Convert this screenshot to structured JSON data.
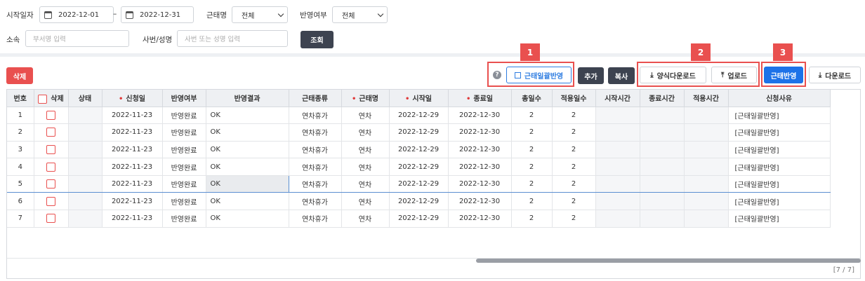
{
  "filters": {
    "start_date_label": "시작일자",
    "start_from": "2022-12-01",
    "date_sep": "–",
    "start_to": "2022-12-31",
    "type_label": "근태명",
    "type_value": "전체",
    "reflect_label": "반영여부",
    "reflect_value": "전체",
    "dept_label": "소속",
    "dept_placeholder": "부서명 입력",
    "emp_label": "사번/성명",
    "emp_placeholder": "사번 또는 성명 입력",
    "search_button": "조회"
  },
  "toolbar": {
    "delete_button": "삭제",
    "help_icon": "?",
    "bulk_reflect_button": "근태일괄반영",
    "add_button": "추가",
    "copy_button": "복사",
    "template_download_button": "양식다운로드",
    "upload_button": "업로드",
    "reflect_button": "근태반영",
    "download_button": "다운로드"
  },
  "annotations": [
    "1",
    "2",
    "3"
  ],
  "table": {
    "headers": {
      "no": "번호",
      "delete": "삭제",
      "status": "상태",
      "apply_date": "신청일",
      "reflected": "반영여부",
      "result": "반영결과",
      "category": "근태종류",
      "type": "근태명",
      "start": "시작일",
      "end": "종료일",
      "total_days": "총일수",
      "applied_days": "적용일수",
      "start_time": "시작시간",
      "end_time": "종료시간",
      "applied_time": "적용시간",
      "reason": "신청사유"
    },
    "rows": [
      {
        "no": "1",
        "apply_date": "2022-11-23",
        "reflected": "반영완료",
        "result": "OK",
        "category": "연차휴가",
        "type": "연차",
        "start": "2022-12-29",
        "end": "2022-12-30",
        "total_days": "2",
        "applied_days": "2",
        "reason": "[근태일괄반영]"
      },
      {
        "no": "2",
        "apply_date": "2022-11-23",
        "reflected": "반영완료",
        "result": "OK",
        "category": "연차휴가",
        "type": "연차",
        "start": "2022-12-29",
        "end": "2022-12-30",
        "total_days": "2",
        "applied_days": "2",
        "reason": "[근태일괄반영]"
      },
      {
        "no": "3",
        "apply_date": "2022-11-23",
        "reflected": "반영완료",
        "result": "OK",
        "category": "연차휴가",
        "type": "연차",
        "start": "2022-12-29",
        "end": "2022-12-30",
        "total_days": "2",
        "applied_days": "2",
        "reason": "[근태일괄반영]"
      },
      {
        "no": "4",
        "apply_date": "2022-11-23",
        "reflected": "반영완료",
        "result": "OK",
        "category": "연차휴가",
        "type": "연차",
        "start": "2022-12-29",
        "end": "2022-12-30",
        "total_days": "2",
        "applied_days": "2",
        "reason": "[근태일괄반영]"
      },
      {
        "no": "5",
        "apply_date": "2022-11-23",
        "reflected": "반영완료",
        "result": "OK",
        "category": "연차휴가",
        "type": "연차",
        "start": "2022-12-29",
        "end": "2022-12-30",
        "total_days": "2",
        "applied_days": "2",
        "reason": "[근태일괄반영]"
      },
      {
        "no": "6",
        "apply_date": "2022-11-23",
        "reflected": "반영완료",
        "result": "OK",
        "category": "연차휴가",
        "type": "연차",
        "start": "2022-12-29",
        "end": "2022-12-30",
        "total_days": "2",
        "applied_days": "2",
        "reason": "[근태일괄반영]"
      },
      {
        "no": "7",
        "apply_date": "2022-11-23",
        "reflected": "반영완료",
        "result": "OK",
        "category": "연차휴가",
        "type": "연차",
        "start": "2022-12-29",
        "end": "2022-12-30",
        "total_days": "2",
        "applied_days": "2",
        "reason": "[근태일괄반영]"
      }
    ],
    "selected_row": 5,
    "counter": "[7 / 7]"
  },
  "colors": {
    "accent": "#1d72e8",
    "danger": "#e9504f",
    "dark": "#3d4350"
  }
}
